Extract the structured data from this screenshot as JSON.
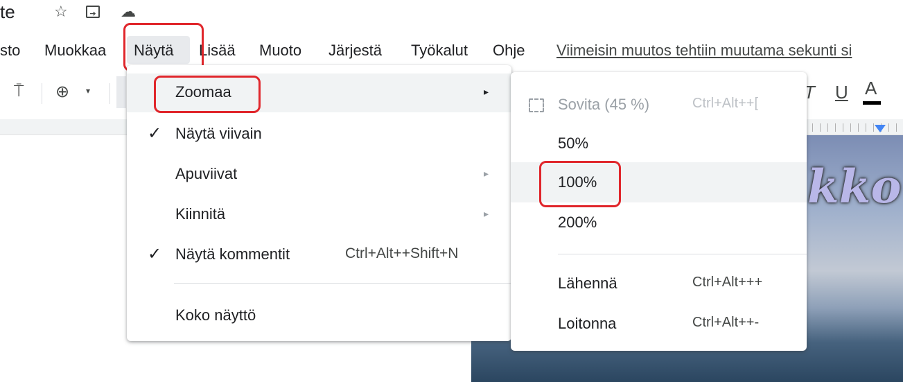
{
  "title_bar": {
    "title_fragment": "te",
    "star_icon": "☆",
    "move_icon": "⊡",
    "cloud_icon": "☁"
  },
  "menubar": {
    "items": [
      "sto",
      "Muokkaa",
      "Näytä",
      "Lisää",
      "Muoto",
      "Järjestä",
      "Työkalut",
      "Ohje"
    ],
    "last_edit": "Viimeisin muutos tehtiin muutama sekunti si"
  },
  "toolbar": {
    "paint_icon": "⍑",
    "zoom_icon": "⊕",
    "zoom_caret": "▾",
    "italic": "T",
    "underline": "U",
    "text_color": "A"
  },
  "slide": {
    "title_fragment": "kko"
  },
  "view_menu": {
    "items": [
      {
        "label": "Zoomaa",
        "checked": false,
        "shortcut": "",
        "arrow": "▸"
      },
      {
        "label": "Näytä viivain",
        "checked": true,
        "shortcut": "",
        "arrow": ""
      },
      {
        "label": "Apuviivat",
        "checked": false,
        "shortcut": "",
        "arrow": "▸"
      },
      {
        "label": "Kiinnitä",
        "checked": false,
        "shortcut": "",
        "arrow": "▸"
      },
      {
        "label": "Näytä kommentit",
        "checked": true,
        "shortcut": "Ctrl+Alt++Shift+N",
        "arrow": ""
      },
      {
        "label": "Koko näyttö",
        "checked": false,
        "shortcut": "",
        "arrow": ""
      }
    ],
    "check_mark": "✓"
  },
  "zoom_submenu": {
    "items": [
      {
        "label": "Sovita (45 %)",
        "shortcut": "Ctrl+Alt++[",
        "disabled": true
      },
      {
        "label": "50%",
        "shortcut": ""
      },
      {
        "label": "100%",
        "shortcut": "",
        "highlighted": true
      },
      {
        "label": "200%",
        "shortcut": ""
      },
      {
        "label": "Lähennä",
        "shortcut": "Ctrl+Alt+++"
      },
      {
        "label": "Loitonna",
        "shortcut": "Ctrl+Alt++-"
      }
    ]
  },
  "colors": {
    "annotation_red": "#e0262b",
    "menu_hover": "#f1f3f4",
    "menubar_active": "#e8eaed"
  }
}
